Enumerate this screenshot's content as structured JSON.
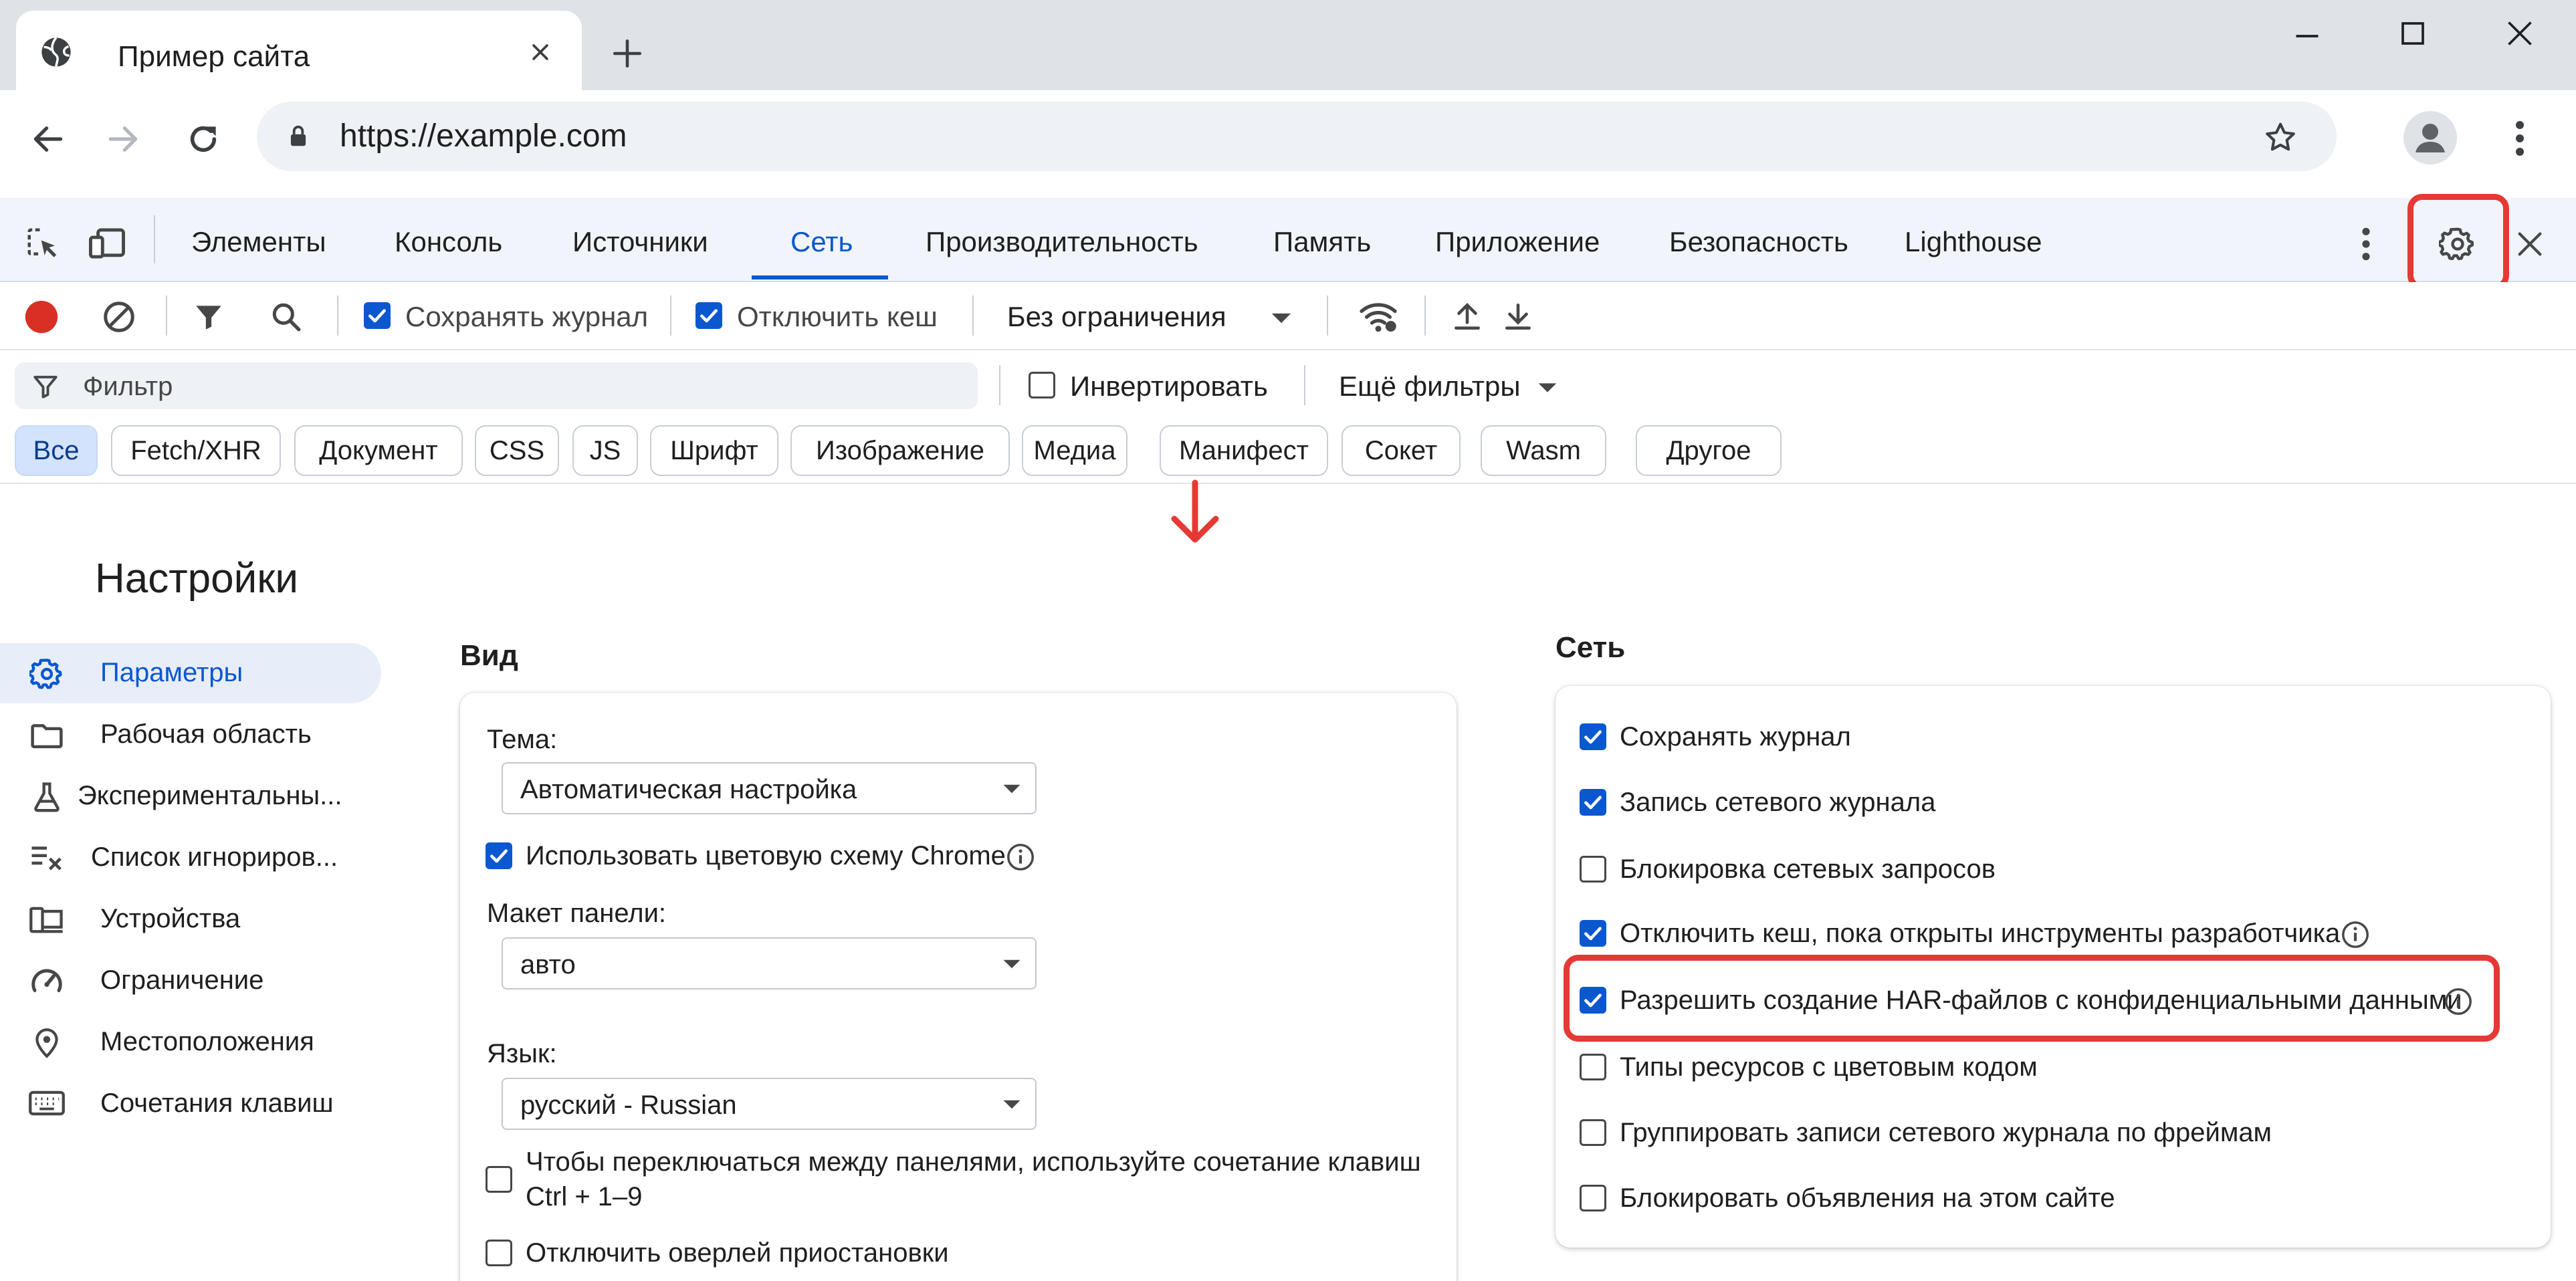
{
  "browser": {
    "tab_title": "Пример сайта",
    "url": "https://example.com"
  },
  "devtools": {
    "tabs": [
      {
        "label": "Элементы",
        "active": false
      },
      {
        "label": "Консоль",
        "active": false
      },
      {
        "label": "Источники",
        "active": false
      },
      {
        "label": "Сеть",
        "active": true
      },
      {
        "label": "Производительность",
        "active": false
      },
      {
        "label": "Память",
        "active": false
      },
      {
        "label": "Приложение",
        "active": false
      },
      {
        "label": "Безопасность",
        "active": false
      },
      {
        "label": "Lighthouse",
        "active": false
      }
    ],
    "network_toolbar": {
      "preserve_log_label": "Сохранять журнал",
      "preserve_log_checked": true,
      "disable_cache_label": "Отключить кеш",
      "disable_cache_checked": true,
      "throttling_value": "Без ограничения"
    },
    "filter": {
      "placeholder": "Фильтр",
      "invert_label": "Инвертировать",
      "invert_checked": false,
      "more_filters_label": "Ещё фильтры"
    },
    "type_chips": [
      "Все",
      "Fetch/XHR",
      "Документ",
      "CSS",
      "JS",
      "Шрифт",
      "Изображение",
      "Медиа",
      "Манифест",
      "Сокет",
      "Wasm",
      "Другое"
    ],
    "active_chip": "Все"
  },
  "settings": {
    "title": "Настройки",
    "nav": [
      {
        "label": "Параметры",
        "icon": "gear-icon",
        "active": true
      },
      {
        "label": "Рабочая область",
        "icon": "folder-icon",
        "active": false
      },
      {
        "label": "Экспериментальны...",
        "icon": "flask-icon",
        "active": false
      },
      {
        "label": "Список игнориров...",
        "icon": "ignore-list-icon",
        "active": false
      },
      {
        "label": "Устройства",
        "icon": "devices-icon",
        "active": false
      },
      {
        "label": "Ограничение",
        "icon": "gauge-icon",
        "active": false
      },
      {
        "label": "Местоположения",
        "icon": "location-pin-icon",
        "active": false
      },
      {
        "label": "Сочетания клавиш",
        "icon": "keyboard-icon",
        "active": false
      }
    ],
    "appearance": {
      "title": "Вид",
      "theme_label": "Тема:",
      "theme_value": "Автоматическая настройка",
      "chrome_color_label": "Использовать цветовую схему Chrome",
      "chrome_color_checked": true,
      "panel_layout_label": "Макет панели:",
      "panel_layout_value": "авто",
      "language_label": "Язык:",
      "language_value": "русский - Russian",
      "shortcut_hint_line1": "Чтобы переключаться между панелями, используйте сочетание клавиш",
      "shortcut_hint_line2": "Ctrl + 1–9",
      "shortcut_hint_checked": false,
      "disable_overlay_label": "Отключить оверлей приостановки",
      "disable_overlay_checked": false
    },
    "network": {
      "title": "Сеть",
      "options": [
        {
          "label": "Сохранять журнал",
          "checked": true,
          "info": false
        },
        {
          "label": "Запись сетевого журнала",
          "checked": true,
          "info": false
        },
        {
          "label": "Блокировка сетевых запросов",
          "checked": false,
          "info": false
        },
        {
          "label": "Отключить кеш, пока открыты инструменты разработчика",
          "checked": true,
          "info": true
        },
        {
          "label": "Разрешить создание HAR-файлов с конфиденциальными данными",
          "checked": true,
          "info": true,
          "highlighted": true
        },
        {
          "label": "Типы ресурсов с цветовым кодом",
          "checked": false,
          "info": false
        },
        {
          "label": "Группировать записи сетевого журнала по фреймам",
          "checked": false,
          "info": false
        },
        {
          "label": "Блокировать объявления на этом сайте",
          "checked": false,
          "info": false
        }
      ]
    }
  },
  "colors": {
    "accent": "#0b57d0",
    "highlight": "#e53935",
    "record": "#d93025"
  }
}
